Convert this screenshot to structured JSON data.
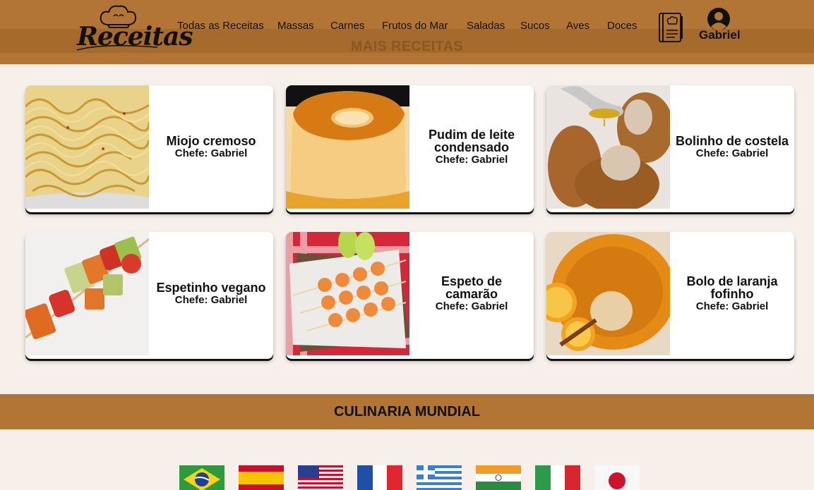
{
  "header": {
    "logo_text": "Receitas",
    "nav": [
      "Todas as Receitas",
      "Massas",
      "Carnes",
      "Frutos do Mar",
      "Saladas",
      "Sucos",
      "Aves",
      "Doces"
    ],
    "user_name": "Gabriel",
    "icons": [
      "chef-hat-icon",
      "recipe-book-icon",
      "user-avatar-icon"
    ]
  },
  "section_title": "MAIS RECEITAS",
  "cards": [
    {
      "title": "Miojo cremoso",
      "chef": "Chefe: Gabriel",
      "image": "noodles-photo"
    },
    {
      "title": "Pudim de leite condensado",
      "chef": "Chefe: Gabriel",
      "image": "flan-photo"
    },
    {
      "title": "Bolinho de costela",
      "chef": "Chefe: Gabriel",
      "image": "croquettes-photo"
    },
    {
      "title": "Espetinho vegano",
      "chef": "Chefe: Gabriel",
      "image": "vegan-skewer-photo"
    },
    {
      "title": "Espeto de camarão",
      "chef": "Chefe: Gabriel",
      "image": "shrimp-skewer-photo"
    },
    {
      "title": "Bolo de laranja fofinho",
      "chef": "Chefe: Gabriel",
      "image": "orange-cake-photo"
    }
  ],
  "mundial_title": "CULINARIA MUNDIAL",
  "flags": [
    "brazil",
    "spain",
    "usa",
    "france",
    "greece",
    "india",
    "italy",
    "japan"
  ],
  "colors": {
    "header": "#b27535",
    "background": "#f6efea",
    "text": "#111111"
  }
}
